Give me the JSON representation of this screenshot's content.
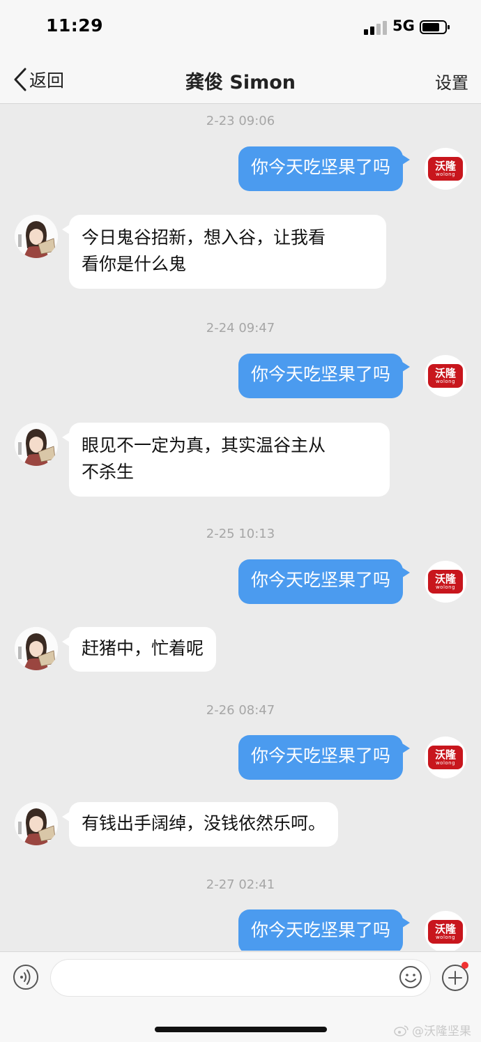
{
  "status_bar": {
    "time": "11:29",
    "network": "5G"
  },
  "nav": {
    "back_label": "返回",
    "title": "龚俊 Simon",
    "settings_label": "设置"
  },
  "brand": {
    "logo_cn": "沃隆",
    "logo_en": "wolong",
    "color": "#c8161d"
  },
  "colors": {
    "outgoing_bubble": "#4b9bef",
    "background": "#ebebeb"
  },
  "messages": [
    {
      "timestamp": "2-23 09:06",
      "outgoing": "你今天吃坚果了吗",
      "reply_lines": [
        "今日鬼谷招新，想入谷，让我看",
        "看你是什么鬼"
      ]
    },
    {
      "timestamp": "2-24 09:47",
      "outgoing": "你今天吃坚果了吗",
      "reply_lines": [
        "眼见不一定为真，其实温谷主从",
        "不杀生"
      ]
    },
    {
      "timestamp": "2-25 10:13",
      "outgoing": "你今天吃坚果了吗",
      "reply_lines": [
        "赶猪中，忙着呢"
      ]
    },
    {
      "timestamp": "2-26 08:47",
      "outgoing": "你今天吃坚果了吗",
      "reply_lines": [
        "有钱出手阔绰，没钱依然乐呵。"
      ]
    },
    {
      "timestamp": "2-27 02:41",
      "outgoing": "你今天吃坚果了吗"
    }
  ],
  "input": {
    "placeholder": ""
  },
  "watermark": "@沃隆坚果"
}
